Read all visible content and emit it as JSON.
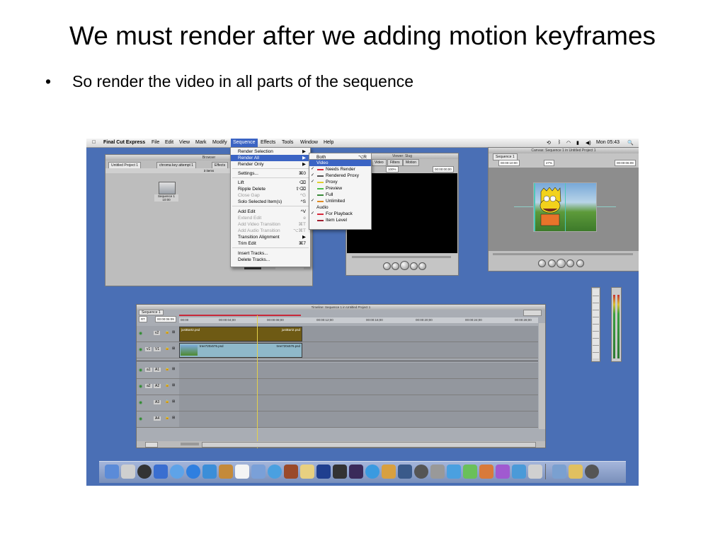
{
  "slide": {
    "title": "We must render after we adding motion keyframes",
    "bullet": "So render the video in all parts of the sequence"
  },
  "menubar": {
    "app": "Final Cut Express",
    "items": [
      "File",
      "Edit",
      "View",
      "Mark",
      "Modify",
      "Sequence",
      "Effects",
      "Tools",
      "Window",
      "Help"
    ],
    "selected": "Sequence",
    "clock": "Mon 05:43"
  },
  "browser": {
    "title": "Browser",
    "tabs": [
      "Untitled Project 1",
      "chroma key attempt 1",
      "Effects"
    ],
    "items_count": "3 items",
    "sequence_label": "Sequence 1",
    "sequence_duration": "10:00",
    "footer_label1": "11:00",
    "footer_label2": "10:00"
  },
  "sequence_menu": {
    "items": [
      {
        "label": "Render Selection",
        "key": "▶"
      },
      {
        "label": "Render All",
        "key": "▶",
        "highlight": true
      },
      {
        "label": "Render Only",
        "key": "▶"
      },
      {
        "label": "Settings...",
        "key": "⌘0"
      },
      {
        "label": "Lift",
        "key": "⌫"
      },
      {
        "label": "Ripple Delete",
        "key": "⇧⌫"
      },
      {
        "label": "Close Gap",
        "key": "^G",
        "disabled": true
      },
      {
        "label": "Solo Selected Item(s)",
        "key": "^S"
      },
      {
        "label": "Add Edit",
        "key": "^V"
      },
      {
        "label": "Extend Edit",
        "key": "e",
        "disabled": true
      },
      {
        "label": "Add Video Transition",
        "key": "⌘T",
        "disabled": true
      },
      {
        "label": "Add Audio Transition",
        "key": "⌥⌘T",
        "disabled": true
      },
      {
        "label": "Transition Alignment",
        "key": "▶"
      },
      {
        "label": "Trim Edit",
        "key": "⌘7"
      },
      {
        "label": "Insert Tracks...",
        "key": ""
      },
      {
        "label": "Delete Tracks...",
        "key": ""
      }
    ]
  },
  "render_submenu": {
    "both": {
      "label": "Both",
      "key": "⌥R"
    },
    "items": [
      {
        "label": "Video",
        "highlight": true
      },
      {
        "label": "Needs Render",
        "check": "✓",
        "color": "#d8283a"
      },
      {
        "label": "Rendered Proxy",
        "check": "✓",
        "color": "#505050"
      },
      {
        "label": "Proxy",
        "check": "✓",
        "color": "#e0d030"
      },
      {
        "label": "Preview",
        "check": "",
        "color": "#48c048"
      },
      {
        "label": "Full",
        "check": "",
        "color": "#3a8a3a"
      },
      {
        "label": "Unlimited",
        "check": "✓",
        "color": "#e08a20"
      },
      {
        "label": "Audio",
        "header": true
      },
      {
        "label": "For Playback",
        "check": "✓",
        "color": "#d8283a"
      },
      {
        "label": "Item Level",
        "check": "",
        "color": "#a02030"
      }
    ]
  },
  "viewer": {
    "tabs": [
      "Video",
      "Filters",
      "Motion"
    ],
    "zoom": "100%",
    "timecode": "00:00:00;00",
    "title": "Viewer: Slug"
  },
  "canvas": {
    "title": "Canvas: Sequence 1 in Untitled Project 1",
    "tab": "Sequence 1",
    "timecode_left": "00:00:10:00",
    "zoom": "27%",
    "timecode_right": "00:00:06:09"
  },
  "timeline": {
    "title": "Timeline: Sequence 1 in Untitled Project 1",
    "tab": "Sequence 1",
    "rt_label": "RT",
    "current_timecode": "00:00:06:09",
    "ruler_marks": [
      "00:00",
      "00:00:04;00",
      "00:00:08;00",
      "00:00:12;00",
      "00:00:16;00",
      "00:00:20;00",
      "00:00:24;00",
      "00:00:28;00"
    ],
    "video_tracks": [
      {
        "dest": "v2",
        "clips": [
          "justBart2.psd",
          "justBart2.psd"
        ]
      },
      {
        "dest": "v1",
        "src": "V1",
        "clips": [
          "tree720x576.psd",
          "tree720x576.psd"
        ]
      }
    ],
    "audio_tracks": [
      {
        "src": "a1",
        "dest": "A1"
      },
      {
        "src": "a2",
        "dest": "A2"
      },
      {
        "dest": "A3"
      },
      {
        "dest": "A4"
      }
    ]
  },
  "colors": {
    "desktop": "#4a6fb5",
    "menu_highlight": "#3b64c4",
    "clip_brown": "#6e5a14",
    "clip_blue": "#8fb8c9"
  }
}
